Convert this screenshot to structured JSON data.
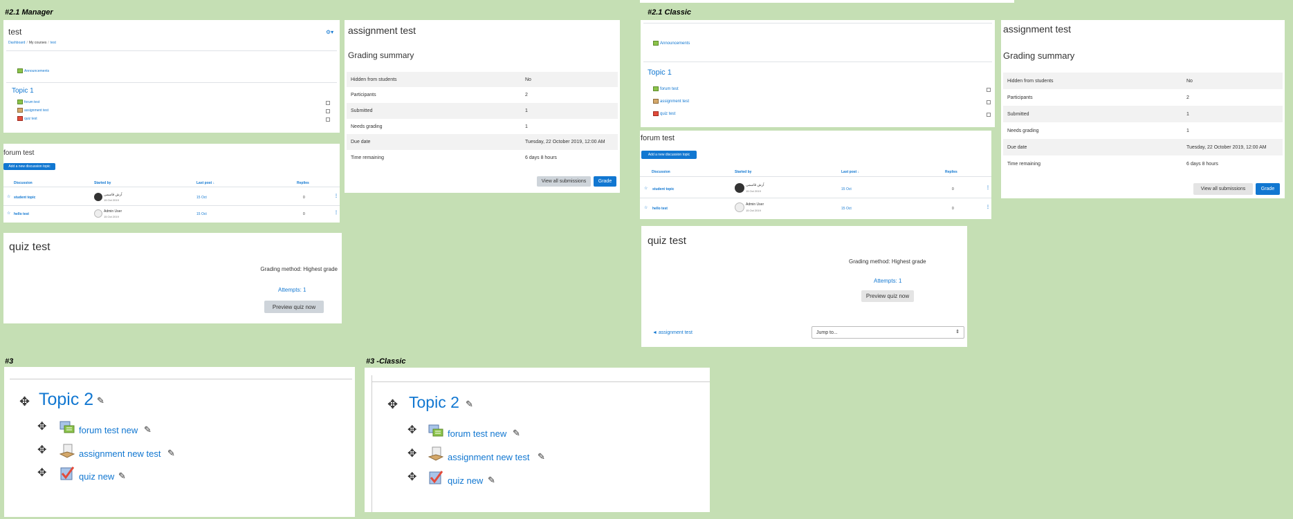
{
  "labels": {
    "s21_manager": "#2.1 Manager",
    "s21_classic": "#2.1 Classic",
    "s3": "#3",
    "s3_classic": "#3 -Classic"
  },
  "course": {
    "title": "test",
    "breadcrumb": [
      "Dashboard",
      "My courses",
      "test"
    ],
    "announcements": "Announcements",
    "topic": "Topic 1",
    "activities": [
      "forum test",
      "assignment test",
      "quiz test"
    ]
  },
  "forum": {
    "title": "forum test",
    "add_button": "Add a new discussion topic",
    "headers": [
      "Discussion",
      "Started by",
      "Last post",
      "Replies"
    ],
    "rows": [
      {
        "discussion": "student topic",
        "author": "آرش قاسمی",
        "author_date": "15 Oct 2019",
        "last_post": "15 Oct",
        "replies": "0"
      },
      {
        "discussion": "hello test",
        "author": "Admin User",
        "author_date": "15 Oct 2019",
        "last_post": "15 Oct",
        "replies": "0"
      }
    ]
  },
  "assignment": {
    "title": "assignment test",
    "summary_title": "Grading summary",
    "rows": [
      {
        "k": "Hidden from students",
        "v": "No"
      },
      {
        "k": "Participants",
        "v": "2"
      },
      {
        "k": "Submitted",
        "v": "1"
      },
      {
        "k": "Needs grading",
        "v": "1"
      },
      {
        "k": "Due date",
        "v": "Tuesday, 22 October 2019, 12:00 AM"
      },
      {
        "k": "Time remaining",
        "v": "6 days 8 hours"
      }
    ],
    "view_all": "View all submissions",
    "grade": "Grade"
  },
  "quiz": {
    "title": "quiz test",
    "grading_method": "Grading method: Highest grade",
    "attempts": "Attempts: 1",
    "preview": "Preview quiz now",
    "prev_link": "◄ assignment test",
    "jump_to": "Jump to..."
  },
  "topic2": {
    "title": "Topic 2",
    "activities": [
      "forum test new",
      "assignment new test",
      "quiz new"
    ]
  },
  "colors": {
    "background": "#c5dfb4",
    "link": "#1177d1",
    "button_primary": "#1177d1",
    "button_secondary": "#ced4da"
  }
}
